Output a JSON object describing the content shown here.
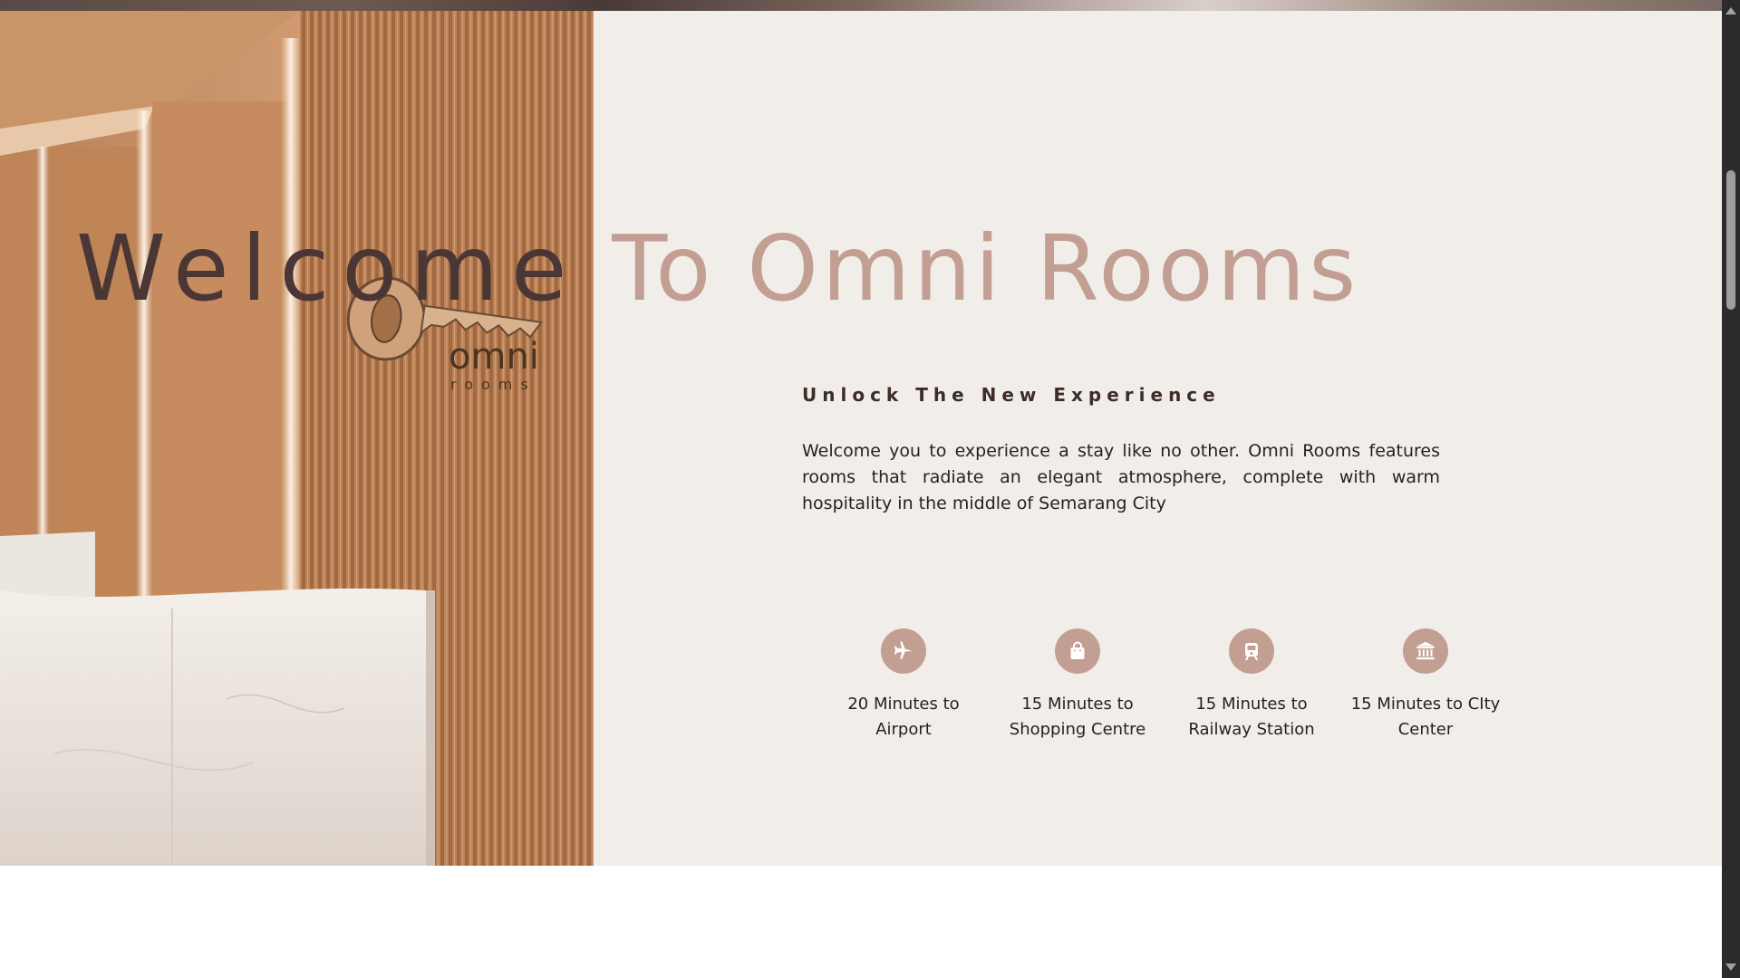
{
  "hero": {
    "title_part1": "Welcome",
    "title_part2": "To Omni Rooms",
    "subtitle": "Unlock The New Experience",
    "description": "Welcome you to experience a stay like no other. Omni Rooms features rooms that radiate an elegant atmosphere, complete with warm hospitality in the middle of Semarang City",
    "photo": {
      "sign_text": "omni",
      "sign_subtext": "rooms"
    },
    "features": [
      {
        "icon": "airplane-icon",
        "line1": "20 Minutes to",
        "line2": "Airport"
      },
      {
        "icon": "shopping-bag-icon",
        "line1": "15 Minutes to",
        "line2": "Shopping Centre"
      },
      {
        "icon": "train-icon",
        "line1": "15 Minutes to",
        "line2": "Railway Station"
      },
      {
        "icon": "landmark-icon",
        "line1": "15 Minutes to CIty",
        "line2": "Center"
      }
    ]
  },
  "colors": {
    "background": "#f1eeea",
    "title_dark": "#4a3735",
    "title_accent": "#c39e92",
    "icon_circle": "#c39e92",
    "text": "#2a201e"
  }
}
